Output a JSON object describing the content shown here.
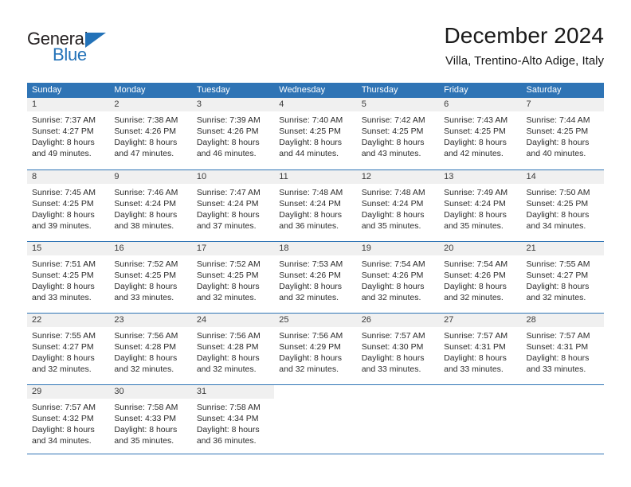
{
  "brand": {
    "name_part1": "General",
    "name_part2": "Blue",
    "triangle_color": "#2372b8",
    "text_color": "#231f20"
  },
  "header": {
    "month_title": "December 2024",
    "location": "Villa, Trentino-Alto Adige, Italy"
  },
  "calendar": {
    "header_bg": "#2f74b5",
    "day_strip_bg": "#f0f0f0",
    "weekdays": [
      "Sunday",
      "Monday",
      "Tuesday",
      "Wednesday",
      "Thursday",
      "Friday",
      "Saturday"
    ],
    "weeks": [
      [
        {
          "day": "1",
          "sunrise": "Sunrise: 7:37 AM",
          "sunset": "Sunset: 4:27 PM",
          "daylight_l1": "Daylight: 8 hours",
          "daylight_l2": "and 49 minutes."
        },
        {
          "day": "2",
          "sunrise": "Sunrise: 7:38 AM",
          "sunset": "Sunset: 4:26 PM",
          "daylight_l1": "Daylight: 8 hours",
          "daylight_l2": "and 47 minutes."
        },
        {
          "day": "3",
          "sunrise": "Sunrise: 7:39 AM",
          "sunset": "Sunset: 4:26 PM",
          "daylight_l1": "Daylight: 8 hours",
          "daylight_l2": "and 46 minutes."
        },
        {
          "day": "4",
          "sunrise": "Sunrise: 7:40 AM",
          "sunset": "Sunset: 4:25 PM",
          "daylight_l1": "Daylight: 8 hours",
          "daylight_l2": "and 44 minutes."
        },
        {
          "day": "5",
          "sunrise": "Sunrise: 7:42 AM",
          "sunset": "Sunset: 4:25 PM",
          "daylight_l1": "Daylight: 8 hours",
          "daylight_l2": "and 43 minutes."
        },
        {
          "day": "6",
          "sunrise": "Sunrise: 7:43 AM",
          "sunset": "Sunset: 4:25 PM",
          "daylight_l1": "Daylight: 8 hours",
          "daylight_l2": "and 42 minutes."
        },
        {
          "day": "7",
          "sunrise": "Sunrise: 7:44 AM",
          "sunset": "Sunset: 4:25 PM",
          "daylight_l1": "Daylight: 8 hours",
          "daylight_l2": "and 40 minutes."
        }
      ],
      [
        {
          "day": "8",
          "sunrise": "Sunrise: 7:45 AM",
          "sunset": "Sunset: 4:25 PM",
          "daylight_l1": "Daylight: 8 hours",
          "daylight_l2": "and 39 minutes."
        },
        {
          "day": "9",
          "sunrise": "Sunrise: 7:46 AM",
          "sunset": "Sunset: 4:24 PM",
          "daylight_l1": "Daylight: 8 hours",
          "daylight_l2": "and 38 minutes."
        },
        {
          "day": "10",
          "sunrise": "Sunrise: 7:47 AM",
          "sunset": "Sunset: 4:24 PM",
          "daylight_l1": "Daylight: 8 hours",
          "daylight_l2": "and 37 minutes."
        },
        {
          "day": "11",
          "sunrise": "Sunrise: 7:48 AM",
          "sunset": "Sunset: 4:24 PM",
          "daylight_l1": "Daylight: 8 hours",
          "daylight_l2": "and 36 minutes."
        },
        {
          "day": "12",
          "sunrise": "Sunrise: 7:48 AM",
          "sunset": "Sunset: 4:24 PM",
          "daylight_l1": "Daylight: 8 hours",
          "daylight_l2": "and 35 minutes."
        },
        {
          "day": "13",
          "sunrise": "Sunrise: 7:49 AM",
          "sunset": "Sunset: 4:24 PM",
          "daylight_l1": "Daylight: 8 hours",
          "daylight_l2": "and 35 minutes."
        },
        {
          "day": "14",
          "sunrise": "Sunrise: 7:50 AM",
          "sunset": "Sunset: 4:25 PM",
          "daylight_l1": "Daylight: 8 hours",
          "daylight_l2": "and 34 minutes."
        }
      ],
      [
        {
          "day": "15",
          "sunrise": "Sunrise: 7:51 AM",
          "sunset": "Sunset: 4:25 PM",
          "daylight_l1": "Daylight: 8 hours",
          "daylight_l2": "and 33 minutes."
        },
        {
          "day": "16",
          "sunrise": "Sunrise: 7:52 AM",
          "sunset": "Sunset: 4:25 PM",
          "daylight_l1": "Daylight: 8 hours",
          "daylight_l2": "and 33 minutes."
        },
        {
          "day": "17",
          "sunrise": "Sunrise: 7:52 AM",
          "sunset": "Sunset: 4:25 PM",
          "daylight_l1": "Daylight: 8 hours",
          "daylight_l2": "and 32 minutes."
        },
        {
          "day": "18",
          "sunrise": "Sunrise: 7:53 AM",
          "sunset": "Sunset: 4:26 PM",
          "daylight_l1": "Daylight: 8 hours",
          "daylight_l2": "and 32 minutes."
        },
        {
          "day": "19",
          "sunrise": "Sunrise: 7:54 AM",
          "sunset": "Sunset: 4:26 PM",
          "daylight_l1": "Daylight: 8 hours",
          "daylight_l2": "and 32 minutes."
        },
        {
          "day": "20",
          "sunrise": "Sunrise: 7:54 AM",
          "sunset": "Sunset: 4:26 PM",
          "daylight_l1": "Daylight: 8 hours",
          "daylight_l2": "and 32 minutes."
        },
        {
          "day": "21",
          "sunrise": "Sunrise: 7:55 AM",
          "sunset": "Sunset: 4:27 PM",
          "daylight_l1": "Daylight: 8 hours",
          "daylight_l2": "and 32 minutes."
        }
      ],
      [
        {
          "day": "22",
          "sunrise": "Sunrise: 7:55 AM",
          "sunset": "Sunset: 4:27 PM",
          "daylight_l1": "Daylight: 8 hours",
          "daylight_l2": "and 32 minutes."
        },
        {
          "day": "23",
          "sunrise": "Sunrise: 7:56 AM",
          "sunset": "Sunset: 4:28 PM",
          "daylight_l1": "Daylight: 8 hours",
          "daylight_l2": "and 32 minutes."
        },
        {
          "day": "24",
          "sunrise": "Sunrise: 7:56 AM",
          "sunset": "Sunset: 4:28 PM",
          "daylight_l1": "Daylight: 8 hours",
          "daylight_l2": "and 32 minutes."
        },
        {
          "day": "25",
          "sunrise": "Sunrise: 7:56 AM",
          "sunset": "Sunset: 4:29 PM",
          "daylight_l1": "Daylight: 8 hours",
          "daylight_l2": "and 32 minutes."
        },
        {
          "day": "26",
          "sunrise": "Sunrise: 7:57 AM",
          "sunset": "Sunset: 4:30 PM",
          "daylight_l1": "Daylight: 8 hours",
          "daylight_l2": "and 33 minutes."
        },
        {
          "day": "27",
          "sunrise": "Sunrise: 7:57 AM",
          "sunset": "Sunset: 4:31 PM",
          "daylight_l1": "Daylight: 8 hours",
          "daylight_l2": "and 33 minutes."
        },
        {
          "day": "28",
          "sunrise": "Sunrise: 7:57 AM",
          "sunset": "Sunset: 4:31 PM",
          "daylight_l1": "Daylight: 8 hours",
          "daylight_l2": "and 33 minutes."
        }
      ],
      [
        {
          "day": "29",
          "sunrise": "Sunrise: 7:57 AM",
          "sunset": "Sunset: 4:32 PM",
          "daylight_l1": "Daylight: 8 hours",
          "daylight_l2": "and 34 minutes."
        },
        {
          "day": "30",
          "sunrise": "Sunrise: 7:58 AM",
          "sunset": "Sunset: 4:33 PM",
          "daylight_l1": "Daylight: 8 hours",
          "daylight_l2": "and 35 minutes."
        },
        {
          "day": "31",
          "sunrise": "Sunrise: 7:58 AM",
          "sunset": "Sunset: 4:34 PM",
          "daylight_l1": "Daylight: 8 hours",
          "daylight_l2": "and 36 minutes."
        },
        {
          "day": "",
          "sunrise": "",
          "sunset": "",
          "daylight_l1": "",
          "daylight_l2": ""
        },
        {
          "day": "",
          "sunrise": "",
          "sunset": "",
          "daylight_l1": "",
          "daylight_l2": ""
        },
        {
          "day": "",
          "sunrise": "",
          "sunset": "",
          "daylight_l1": "",
          "daylight_l2": ""
        },
        {
          "day": "",
          "sunrise": "",
          "sunset": "",
          "daylight_l1": "",
          "daylight_l2": ""
        }
      ]
    ]
  }
}
